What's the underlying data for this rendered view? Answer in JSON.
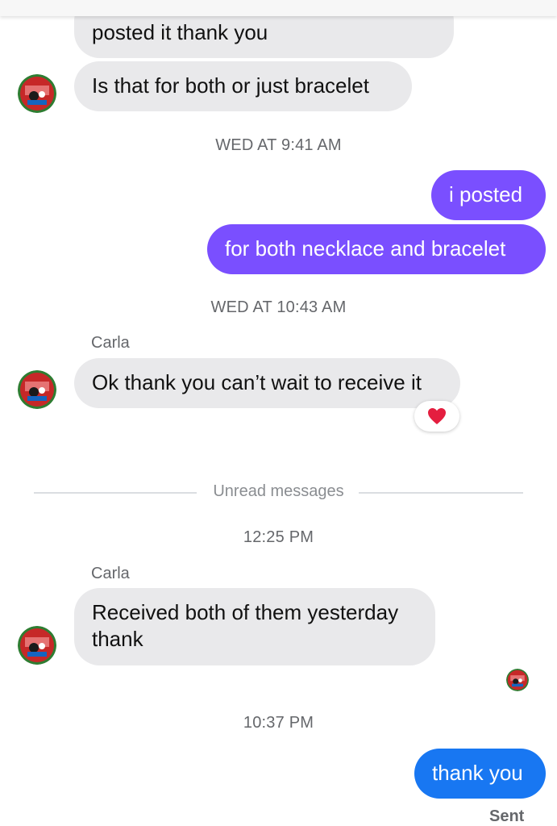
{
  "messages": [
    {
      "text": "posted it thank you"
    },
    {
      "text": "Is that for both or just bracelet"
    },
    {
      "text": "i posted"
    },
    {
      "text": "for both necklace and bracelet"
    },
    {
      "text": "Ok thank you can’t wait to receive it",
      "reaction": "heart-emoji"
    },
    {
      "text": "Received both of them yesterday thank"
    },
    {
      "text": "thank you"
    }
  ],
  "timestamps": [
    "WED AT 9:41 AM",
    "WED AT 10:43 AM",
    "12:25 PM",
    "10:37 PM"
  ],
  "sender_name": "Carla",
  "unread_label": "Unread messages",
  "status": "Sent",
  "colors": {
    "incoming_bubble": "#e9e9eb",
    "outgoing_purple": "#7a4fff",
    "outgoing_blue": "#1877f2",
    "reaction_heart": "#e41e3f"
  }
}
